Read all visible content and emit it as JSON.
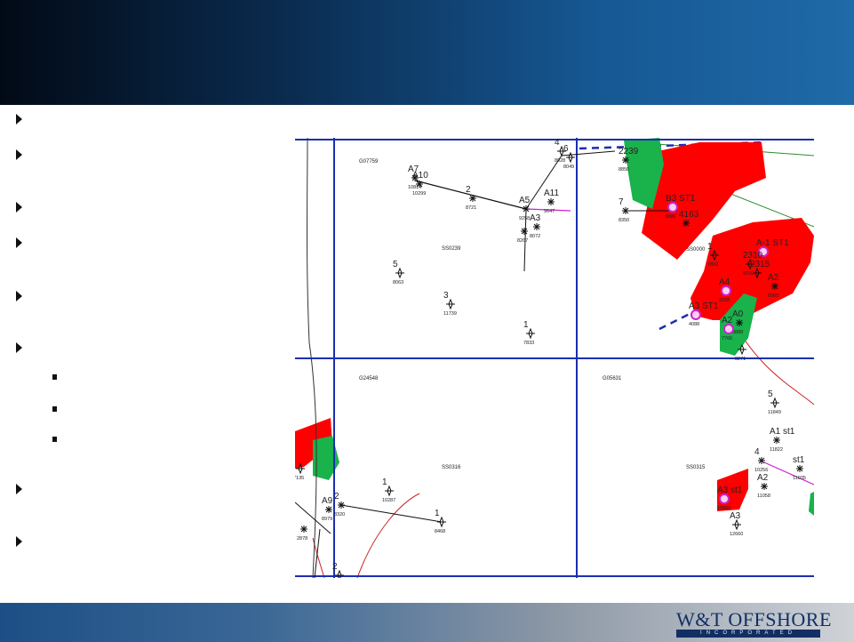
{
  "colors": {
    "header_dark": "#020a16",
    "header_light": "#1f6aa8",
    "grid_blue": "#1a2fb0",
    "lease_red": "#ff0000",
    "lease_green": "#19b24b",
    "pipeline_green": "#2e8b2e",
    "pipeline_magenta": "#cc22cc",
    "footer_dark": "#1d4f86",
    "logo_navy": "#122f63"
  },
  "bullets": {
    "count": 8,
    "sub_count": 3
  },
  "map": {
    "blocks": [
      {
        "id": "b1",
        "label": "G07759"
      },
      {
        "id": "b2",
        "label": "SS0239"
      },
      {
        "id": "b3",
        "label": "G24548"
      },
      {
        "id": "b4",
        "label": "G05631"
      },
      {
        "id": "b5",
        "label": "SS0316"
      },
      {
        "id": "b6",
        "label": "SS0315"
      },
      {
        "id": "b7",
        "label": "SS0000"
      }
    ],
    "wells": [
      {
        "id": "w_a7",
        "name": "A7",
        "depth": "10814"
      },
      {
        "id": "w_a10",
        "name": "A10",
        "depth": "10299"
      },
      {
        "id": "w_2a",
        "name": "2",
        "depth": "8721"
      },
      {
        "id": "w_a5",
        "name": "A5",
        "depth": "9258"
      },
      {
        "id": "w_a11",
        "name": "A11",
        "depth": "9647"
      },
      {
        "id": "w_a3",
        "name": "A3",
        "depth": "8072"
      },
      {
        "id": "w_a9",
        "name": "",
        "depth": "8267"
      },
      {
        "id": "w_5",
        "name": "5",
        "depth": "8063"
      },
      {
        "id": "w_3",
        "name": "3",
        "depth": "11739"
      },
      {
        "id": "w_1a",
        "name": "1",
        "depth": "7833"
      },
      {
        "id": "w_4",
        "name": "4",
        "depth": "8028"
      },
      {
        "id": "w_6",
        "name": "6",
        "depth": "8049"
      },
      {
        "id": "w_2239",
        "name": "2239",
        "depth": "8850"
      },
      {
        "id": "w_b3st1",
        "name": "B3 ST1",
        "depth": "8886"
      },
      {
        "id": "w_7",
        "name": "7",
        "depth": "8350"
      },
      {
        "id": "w_4163",
        "name": "4163",
        "depth": ""
      },
      {
        "id": "w_1b",
        "name": "1",
        "depth": "7862"
      },
      {
        "id": "w_a1st1",
        "name": "A-1 ST1",
        "depth": ""
      },
      {
        "id": "w_2310",
        "name": "2310",
        "depth": "9150"
      },
      {
        "id": "w_2315",
        "name": "2315",
        "depth": ""
      },
      {
        "id": "w_a2",
        "name": "A2",
        "depth": "8060"
      },
      {
        "id": "w_a4",
        "name": "A4",
        "depth": "9928"
      },
      {
        "id": "w_a3st1",
        "name": "A3 ST1",
        "depth": "4088"
      },
      {
        "id": "w_a0",
        "name": "A0",
        "depth": "8888"
      },
      {
        "id": "w_a2b",
        "name": "A2",
        "depth": "7766"
      },
      {
        "id": "w_8271",
        "name": "",
        "depth": "8271"
      },
      {
        "id": "w_5b",
        "name": "5",
        "depth": "11849"
      },
      {
        "id": "w_a1st1b",
        "name": "A1 st1",
        "depth": "11822"
      },
      {
        "id": "w_4b",
        "name": "4",
        "depth": "10256"
      },
      {
        "id": "w_st1",
        "name": "st1",
        "depth": "11035"
      },
      {
        "id": "w_a3st1b",
        "name": "A3 st1",
        "depth": "10860"
      },
      {
        "id": "w_a2c",
        "name": "A2",
        "depth": "11058"
      },
      {
        "id": "w_a3c",
        "name": "A3",
        "depth": "12660"
      },
      {
        "id": "w_1c",
        "name": "1",
        "depth": "10287"
      },
      {
        "id": "w_2b",
        "name": "2",
        "depth": "8320"
      },
      {
        "id": "w_a9b",
        "name": "A9",
        "depth": "8979"
      },
      {
        "id": "w_1d",
        "name": "1",
        "depth": "8468"
      },
      {
        "id": "w_2878",
        "name": "",
        "depth": "2878"
      },
      {
        "id": "w_2c",
        "name": "2",
        "depth": ""
      },
      {
        "id": "w_7135",
        "name": "",
        "depth": "7135"
      }
    ]
  },
  "footer": {
    "logo_text": "W&T OFFSHORE",
    "logo_sub": "INCORPORATED"
  }
}
